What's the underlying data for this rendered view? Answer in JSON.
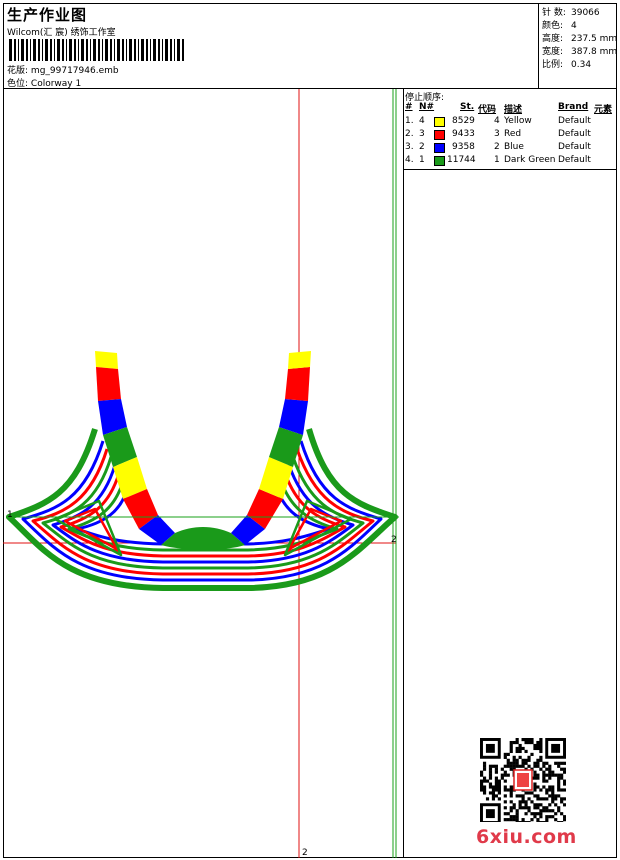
{
  "header": {
    "title": "生产作业图",
    "company": "Wilcom(汇 宸) 绣饰工作室",
    "design_label": "花版:",
    "design_file": "mg_99717946.emb",
    "colorway_label": "色位:",
    "colorway": "Colorway 1"
  },
  "stats": [
    {
      "label": "针 数:",
      "value": "39066"
    },
    {
      "label": "颜色:",
      "value": "4"
    },
    {
      "label": "高度:",
      "value": "237.5 mm"
    },
    {
      "label": "宽度:",
      "value": "387.8 mm"
    },
    {
      "label": "比例:",
      "value": "0.34"
    }
  ],
  "stop_sequence": {
    "title": "停止顺序:",
    "headers": {
      "seq": "#",
      "needle": "N#",
      "stitches": "St.",
      "code": "代码",
      "desc": "描述",
      "brand": "Brand",
      "element": "元素"
    },
    "rows": [
      {
        "seq": "1.",
        "needle": "4",
        "color": "#ffff00",
        "stitches": "8529",
        "code": "4",
        "desc": "Yellow",
        "brand": "Default"
      },
      {
        "seq": "2.",
        "needle": "3",
        "color": "#ff0000",
        "stitches": "9433",
        "code": "3",
        "desc": "Red",
        "brand": "Default"
      },
      {
        "seq": "3.",
        "needle": "2",
        "color": "#0000ff",
        "stitches": "9358",
        "code": "2",
        "desc": "Blue",
        "brand": "Default"
      },
      {
        "seq": "4.",
        "needle": "1",
        "color": "#1a9a1a",
        "stitches": "11744",
        "code": "1",
        "desc": "Dark Green",
        "brand": "Default"
      }
    ]
  },
  "guides": {
    "left_marker": "1",
    "right_marker": "2",
    "bottom_marker": "2"
  },
  "watermark": "6xiu.com"
}
